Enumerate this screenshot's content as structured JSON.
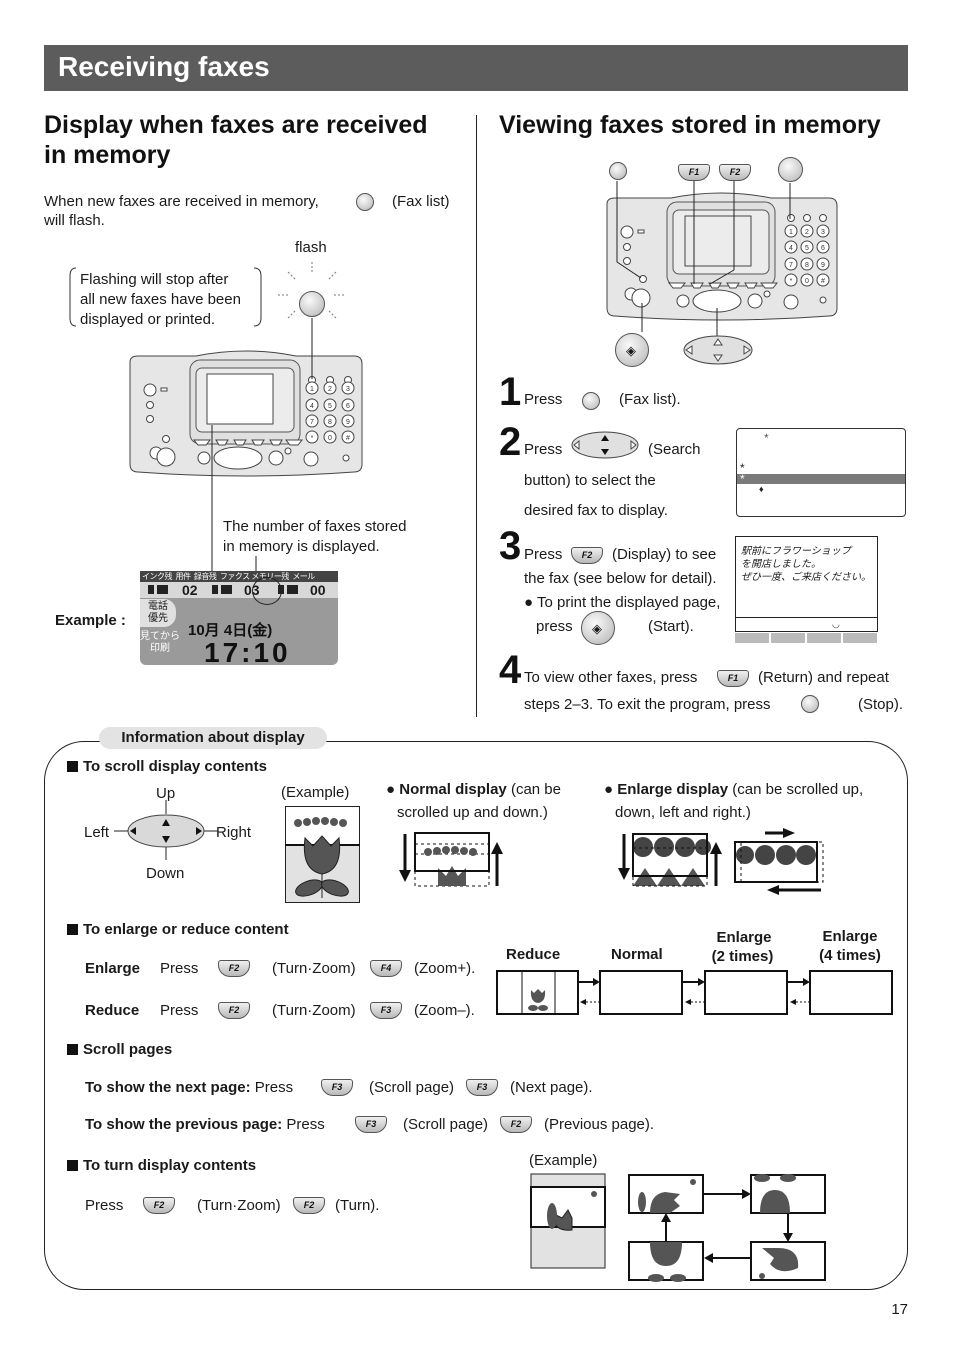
{
  "page": {
    "title": "Receiving faxes",
    "page_number": "17"
  },
  "left": {
    "heading_line1": "Display when faxes are received",
    "heading_line2": "in memory",
    "intro_prefix": "When new faxes are received in memory,",
    "intro_button": "(Fax list)",
    "intro_suffix": "will flash.",
    "flash_label": "flash",
    "note_line1": "Flashing will stop after",
    "note_line2": "all new faxes have been",
    "note_line3": "displayed or printed.",
    "count_note_line1": "The number of faxes stored",
    "count_note_line2": "in memory is displayed.",
    "example_label": "Example :",
    "lcd": {
      "headers": [
        "インク残",
        "用件",
        "録音残",
        "ファクス",
        "メモリー残",
        "メール"
      ],
      "values": [
        "02",
        "03",
        "00"
      ],
      "side_top": [
        "電話",
        "優先"
      ],
      "side_bottom": [
        "見てから",
        "印刷"
      ],
      "date": "10月  4日(金)",
      "time": "17:10"
    }
  },
  "right": {
    "heading": "Viewing faxes stored in memory",
    "device_keys": {
      "f1": "F1",
      "f2": "F2"
    },
    "steps": [
      {
        "num": "1",
        "press": "Press",
        "after": "(Fax list)."
      },
      {
        "num": "2",
        "press": "Press",
        "after": "(Search",
        "line2": "button) to select the",
        "line3": "desired fax to display."
      },
      {
        "num": "3",
        "press": "Press",
        "key": "F2",
        "after": "(Display) to see",
        "line2": "the fax (see below for detail).",
        "bullet": "To print the displayed page,",
        "bullet2": "press",
        "bullet2_after": "(Start)."
      },
      {
        "num": "4",
        "line1": "To view other faxes, press",
        "key": "F1",
        "after": "(Return) and repeat",
        "line2": "steps 2–3. To exit the program, press",
        "line2_after": "(Stop)."
      }
    ],
    "list_screen": {
      "marks": [
        "*",
        "*",
        "*",
        "♦"
      ]
    },
    "fax_screen": {
      "lines": [
        "駅前にフラワーショップ",
        "を開店しました。",
        "ぜひ一度、ご来店ください。"
      ]
    }
  },
  "info": {
    "tab_label": "Information about display",
    "scroll": {
      "heading": "To scroll display contents",
      "up": "Up",
      "down": "Down",
      "left": "Left",
      "right": "Right",
      "example": "(Example)",
      "normal_bold": "Normal display",
      "normal_rest": " (can be",
      "normal_line2": "scrolled up and down.)",
      "enlarge_bold": "Enlarge display",
      "enlarge_rest": " (can be scrolled up,",
      "enlarge_line2": "down, left and right.)"
    },
    "zoom": {
      "heading": "To enlarge or reduce content",
      "enlarge_label": "Enlarge",
      "reduce_label": "Reduce",
      "press": "Press",
      "key_f2": "F2",
      "key_f4": "F4",
      "key_f3": "F3",
      "turn_zoom": "(Turn·Zoom)",
      "zoom_plus": "(Zoom+).",
      "zoom_minus": "(Zoom–).",
      "levels": [
        "Reduce",
        "Normal",
        "Enlarge (2 times)",
        "Enlarge (4 times)"
      ],
      "level_normal": "Normal",
      "level_reduce": "Reduce",
      "level_2x_a": "Enlarge",
      "level_2x_b": "(2 times)",
      "level_4x_a": "Enlarge",
      "level_4x_b": "(4 times)"
    },
    "pages": {
      "heading": "Scroll pages",
      "next_bold": "To show the next page:",
      "prev_bold": "To show the previous page:",
      "press": "Press",
      "key_f3": "F3",
      "key_f2": "F2",
      "scroll_page": "(Scroll page)",
      "next_page": "(Next page).",
      "prev_page": "(Previous page)."
    },
    "turn": {
      "heading": "To turn display contents",
      "press": "Press",
      "key_f2": "F2",
      "turn_zoom": "(Turn·Zoom)",
      "turn": "(Turn).",
      "example": "(Example)"
    }
  }
}
